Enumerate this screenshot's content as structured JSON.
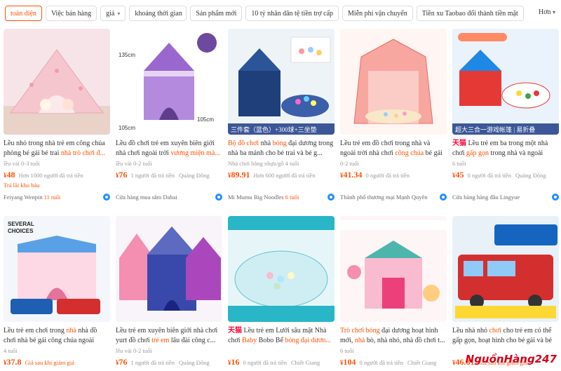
{
  "filters": [
    {
      "label": "toàn diện",
      "active": true,
      "caret": false
    },
    {
      "label": "Việc bán hàng",
      "active": false,
      "caret": false
    },
    {
      "label": "giá",
      "active": false,
      "caret": true
    },
    {
      "label": "khoảng thời gian",
      "active": false,
      "caret": false,
      "wide": true
    },
    {
      "label": "Sản phẩm mới",
      "active": false,
      "caret": false
    },
    {
      "label": "10 tỷ nhân dân tệ tiền trợ cấp",
      "active": false,
      "caret": false
    },
    {
      "label": "Miễn phí vận chuyển",
      "active": false,
      "caret": false
    },
    {
      "label": "Tiền xu Taobao đổi thành tiền mặt",
      "active": false,
      "caret": false
    }
  ],
  "more_label": "Hơn",
  "products": [
    {
      "title_parts": [
        {
          "t": "Lều nhỏ trong nhà trẻ em công chúa phòng bé gái bé trai "
        },
        {
          "t": "nhà trò chơi đ...",
          "hl": true
        }
      ],
      "meta": "lều vải   0-3 tuổi",
      "price": "48",
      "sold": "Hơn 1000 người đã trả tiền",
      "loc": "",
      "tagline": "Trả lãi kho báu",
      "store": "Feiyang Wenpin",
      "store_yrs": "11 tuổi",
      "overlay": ""
    },
    {
      "title_parts": [
        {
          "t": "Lều đồ chơi trẻ em xuyên biên giới nhà chơi ngoài trời "
        },
        {
          "t": "vương miện mà...",
          "hl": true
        }
      ],
      "meta": "lều vải   0-2 tuổi",
      "price": "76",
      "sold": "1 người đã trả tiền",
      "loc": "Quảng Đông",
      "tagline": "",
      "store": "Cửa hàng mua sắm Dahai",
      "store_yrs": "",
      "overlay": ""
    },
    {
      "title_parts": [
        {
          "t": "Bộ đồ chơi",
          "hl": true
        },
        {
          "t": " nhà "
        },
        {
          "t": "bóng",
          "hl": true
        },
        {
          "t": " đại dương trong nhà ba mảnh cho bé trai và bé g..."
        }
      ],
      "meta": "Nhà chơi bằng nhựa/gỗ   4 tuổi",
      "price": "89.91",
      "sold": "Hơn 600 người đã trả tiền",
      "loc": "",
      "tagline": "",
      "store": "Mi Mumu Big Noodles",
      "store_yrs": "6 tuổi",
      "overlay": "三件套（蓝色）+300球+三坐垫"
    },
    {
      "title_parts": [
        {
          "t": "Lều trẻ em đồ chơi trong nhà và ngoài trời nhà chơi "
        },
        {
          "t": "công chúa",
          "hl": true
        },
        {
          "t": " bé gái n..."
        }
      ],
      "meta": "0-2 tuổi",
      "price": "41.34",
      "sold": "0 người đã trả tiền",
      "loc": "",
      "tagline": "",
      "store": "Thành phố thương mại Mạnh Quyên",
      "store_yrs": "",
      "overlay": ""
    },
    {
      "title_parts": [
        {
          "t": "天猫",
          "brand": true
        },
        {
          "t": " Lều trẻ em ba trong một nhà chơi "
        },
        {
          "t": "gấp gọn",
          "hl": true
        },
        {
          "t": " trong nhà và ngoài trời..."
        }
      ],
      "meta": "6 tuổi",
      "price": "45",
      "sold": "0 người đã trả tiền",
      "loc": "Quảng Đông",
      "tagline": "",
      "store": "Cửa hàng hàng đầu Lingyue",
      "store_yrs": "",
      "overlay": "超大三合一游戏帐篷 | 易折叠",
      "overlay_color": "blue"
    },
    {
      "title_parts": [
        {
          "t": "Lều trẻ em chơi trong "
        },
        {
          "t": "nhà",
          "hl": true
        },
        {
          "t": " nhà đồ chơi nhà bé gái công chúa ngoài trời..."
        }
      ],
      "meta": "4 tuổi",
      "price": "37.8",
      "sold": "",
      "loc": "",
      "tagline_inline": "Giá sau khi giảm giá",
      "store": "",
      "store_yrs": "",
      "overlay": ""
    },
    {
      "title_parts": [
        {
          "t": "Lều trẻ em xuyên biên giới nhà chơi yurt đồ chơi "
        },
        {
          "t": "trẻ em",
          "hl": true
        },
        {
          "t": " lâu đài công c..."
        }
      ],
      "meta": "lều vải   0-2 tuổi",
      "price": "76",
      "sold": "1 người đã trả tiền",
      "loc": "Quảng Đông",
      "store": "",
      "store_yrs": "",
      "overlay": ""
    },
    {
      "title_parts": [
        {
          "t": "天猫",
          "brand": true
        },
        {
          "t": " Lều trẻ em Lưới sâu mặt Nhà chơi "
        },
        {
          "t": "Baby",
          "hl": true
        },
        {
          "t": " Bobo Bể "
        },
        {
          "t": "bóng đại dươn...",
          "hl": true
        }
      ],
      "meta": "",
      "price": "16",
      "sold": "0 người đã trả tiền",
      "loc": "Chiết Giang",
      "store": "",
      "store_yrs": "",
      "overlay": ""
    },
    {
      "title_parts": [
        {
          "t": "Trò chơi bóng",
          "hl": true
        },
        {
          "t": " đại dương hoạt hình mới, "
        },
        {
          "t": "nhà",
          "hl": true
        },
        {
          "t": " bò, nhà nhỏ, nhà đồ chơi t..."
        }
      ],
      "meta": "6 tuổi",
      "price": "104",
      "sold": "0 người đã trả tiền",
      "loc": "Chiết Giang",
      "store": "",
      "store_yrs": "",
      "overlay": ""
    },
    {
      "title_parts": [
        {
          "t": "Lều nhà nhỏ "
        },
        {
          "t": "chơi",
          "hl": true
        },
        {
          "t": " cho trẻ em có thể gấp gọn, hoạt hình cho bé gái và bé trai, nhà..."
        }
      ],
      "meta": "",
      "price": "46.81",
      "sold": "",
      "loc": "",
      "tagline_inline": "Giá sau khi giảm giá",
      "store": "",
      "store_yrs": "",
      "overlay": ""
    }
  ],
  "watermark": "NguồnHàng247",
  "colors": {
    "accent": "#ff5000",
    "tmall": "#ff0036",
    "watermark": "#d0021b"
  }
}
